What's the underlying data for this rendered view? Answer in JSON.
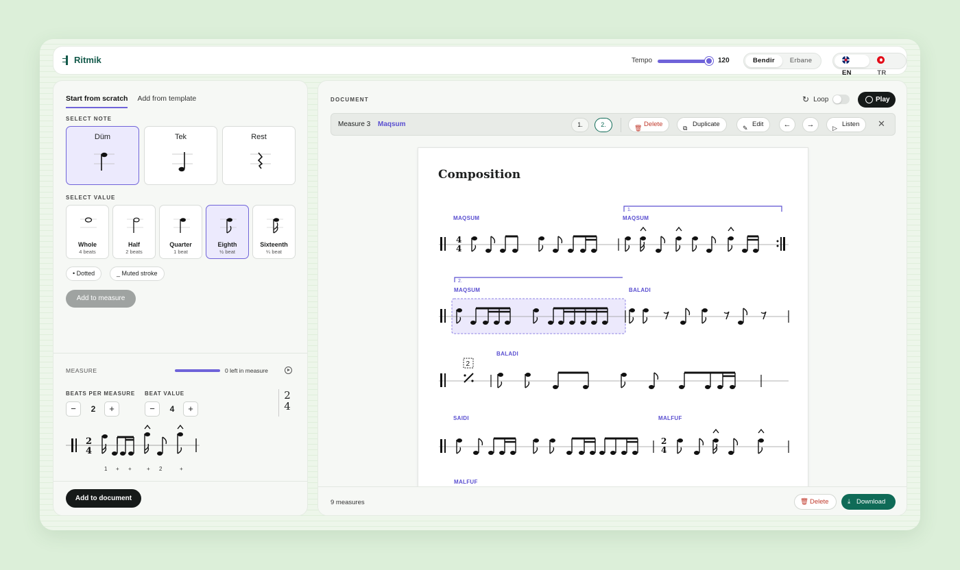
{
  "app": {
    "name": "Ritmik"
  },
  "header": {
    "tempo_label": "Tempo",
    "tempo_value": "120",
    "instruments": [
      "Bendir",
      "Erbane"
    ],
    "instrument_selected": "Bendir",
    "languages": [
      "EN",
      "TR"
    ],
    "language_selected": "EN"
  },
  "left": {
    "tabs": [
      "Start from scratch",
      "Add from template"
    ],
    "select_note_label": "SELECT NOTE",
    "notes": [
      "Düm",
      "Tek",
      "Rest"
    ],
    "select_value_label": "SELECT VALUE",
    "values": [
      {
        "name": "Whole",
        "beats": "4 beats"
      },
      {
        "name": "Half",
        "beats": "2 beats"
      },
      {
        "name": "Quarter",
        "beats": "1 beat"
      },
      {
        "name": "Eighth",
        "beats": "½ beat"
      },
      {
        "name": "Sixteenth",
        "beats": "¼ beat"
      }
    ],
    "modifiers": [
      "• Dotted",
      "_ Muted stroke"
    ],
    "add_to_measure": "Add to measure",
    "measure_label": "MEASURE",
    "measure_left": "0 left in measure",
    "beats_per_measure_label": "BEATS PER MEASURE",
    "beats_per_measure": "2",
    "beat_value_label": "BEAT VALUE",
    "beat_value": "4",
    "time_sig_top": "2",
    "time_sig_bottom": "4",
    "counts": [
      "1",
      "+",
      "+",
      "+",
      "2",
      "+"
    ],
    "minus": "−",
    "plus": "+",
    "add_to_document": "Add to document"
  },
  "document": {
    "label": "DOCUMENT",
    "loop_label": "Loop",
    "play_label": "Play",
    "measure_bar": {
      "title": "Measure 3",
      "rhythm": "Maqsum",
      "endings": [
        "1.",
        "2."
      ],
      "delete": "Delete",
      "duplicate": "Duplicate",
      "edit": "Edit",
      "listen": "Listen"
    },
    "composition_title": "Composition",
    "rhythm_labels": [
      "MAQSUM",
      "MAQSUM",
      "MAQSUM",
      "BALADI",
      "BALADI",
      "SAIDI",
      "MALFUF",
      "MALFUF"
    ],
    "ending_labels": [
      "1.",
      "2."
    ],
    "repeat_count": "2",
    "measure_count": "9 measures",
    "footer_delete": "Delete",
    "footer_download": "Download"
  },
  "colors": {
    "accent": "#6f63d9",
    "primary_dark": "#161a19",
    "download_green": "#0f6b57",
    "delete_red": "#c0392b"
  }
}
